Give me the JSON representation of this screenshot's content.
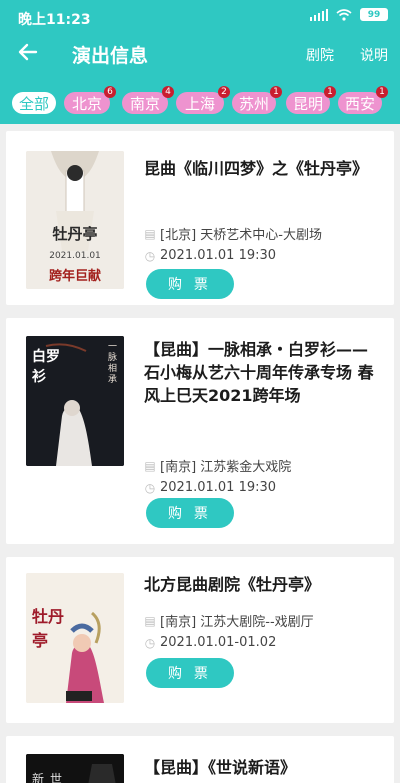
{
  "status_bar": {
    "time": "晚上11:23",
    "battery": "99"
  },
  "header": {
    "title": "演出信息",
    "back_icon": "arrow-left-icon",
    "links": [
      "剧院",
      "说明"
    ]
  },
  "cities": [
    {
      "label": "全部"
    },
    {
      "label": "北京",
      "count": "6"
    },
    {
      "label": "南京",
      "count": "4"
    },
    {
      "label": "上海",
      "count": "2"
    },
    {
      "label": "苏州",
      "count": "1"
    },
    {
      "label": "昆明",
      "count": "1"
    },
    {
      "label": "西安",
      "count": "1"
    }
  ],
  "events": [
    {
      "title": "昆曲《临川四梦》之《牡丹亭》",
      "venue": "[北京] 天桥艺术中心-大剧场",
      "time": "2021.01.01 19:30",
      "buy_label": "购 票",
      "poster": {
        "title": "牡丹亭",
        "sub": "2021.01.01",
        "tag": "跨年巨献"
      }
    },
    {
      "title": "【昆曲】一脉相承・白罗衫——石小梅从艺六十周年传承专场 春风上巳天2021跨年场",
      "venue": "[南京] 江苏紫金大戏院",
      "time": "2021.01.01 19:30",
      "buy_label": "购 票",
      "poster": {
        "title": "白罗衫",
        "sub": "一脉相承"
      }
    },
    {
      "title": "北方昆曲剧院《牡丹亭》",
      "venue": "[南京] 江苏大剧院--戏剧厅",
      "time": "2021.01.01-01.02",
      "buy_label": "购 票",
      "poster": {
        "title": "牡丹亭"
      }
    },
    {
      "title": "【昆曲】《世说新语》",
      "poster": {
        "title": "新世"
      }
    }
  ]
}
